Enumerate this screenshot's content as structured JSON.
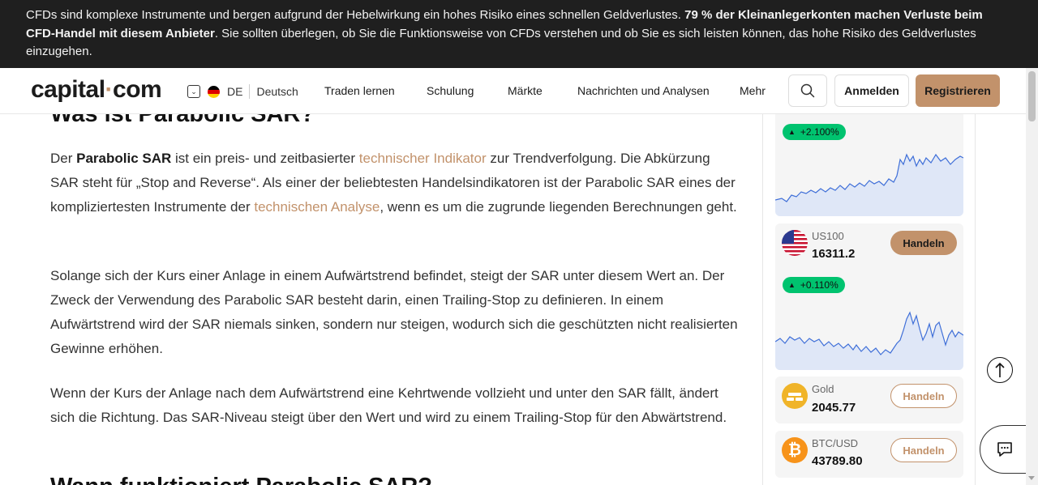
{
  "risk_banner": {
    "text_part1": "CFDs sind komplexe Instrumente und bergen aufgrund der Hebelwirkung ein hohes Risiko eines schnellen Geldverlustes. ",
    "text_bold": "79 % der Kleinanlegerkonten machen Verluste beim CFD-Handel mit diesem Anbieter",
    "text_part2": ". Sie sollten überlegen, ob Sie die Funktionsweise von CFDs verstehen und ob Sie es sich leisten können, das hohe Risiko des Geldverlustes einzugehen."
  },
  "header": {
    "logo_part1": "capital",
    "logo_dot": "·",
    "logo_part2": "com",
    "lang_code": "DE",
    "lang_name": "Deutsch",
    "nav": [
      "Traden lernen",
      "Schulung",
      "Märkte",
      "Nachrichten und Analysen",
      "Mehr"
    ],
    "login_label": "Anmelden",
    "register_label": "Registrieren",
    "search_icon": "search-icon"
  },
  "article": {
    "heading_top": "Was ist Parabolic SAR?",
    "p1_pre": "Der ",
    "p1_bold": "Parabolic SAR",
    "p1_mid1": " ist ein preis- und zeitbasierter ",
    "p1_link1": "technischer Indikator",
    "p1_mid2": " zur Trendverfolgung. Die Abkürzung SAR steht für „Stop and Reverse“. Als einer der beliebtesten Handelsindikatoren ist der Parabolic SAR eines der kompliziertesten Instrumente der ",
    "p1_link2": "technischen Analyse",
    "p1_end": ", wenn es um die zugrunde liegenden Berechnungen geht.",
    "p2": "Solange sich der Kurs einer Anlage in einem Aufwärtstrend befindet, steigt der SAR unter diesem Wert an. Der Zweck der Verwendung des Parabolic SAR besteht darin, einen Trailing-Stop zu definieren. In einem Aufwärtstrend wird der SAR niemals sinken, sondern nur steigen, wodurch sich die geschützten nicht realisierten Gewinne erhöhen.",
    "p3": "Wenn der Kurs der Anlage nach dem Aufwärtstrend eine Kehrtwende vollzieht und unter den SAR fällt, ändert sich die Richtung. Das SAR-Niveau steigt über den Wert und wird zu einem Trailing-Stop für den Abwärtstrend.",
    "heading_bottom": "Wann funktioniert Parabolic SAR?"
  },
  "sidebar": {
    "card_top": {
      "change": "+2.100%"
    },
    "markets": [
      {
        "name": "US100",
        "price": "16311.2",
        "change": "+0.110%",
        "button": "Handeln",
        "icon": "us-flag-icon"
      },
      {
        "name": "Gold",
        "price": "2045.77",
        "button": "Handeln",
        "icon": "gold-icon"
      },
      {
        "name": "BTC/USD",
        "price": "43789.80",
        "button": "Handeln",
        "icon": "bitcoin-icon"
      }
    ]
  },
  "colors": {
    "accent": "#c2926b",
    "positive": "#00c36f",
    "banner_bg": "#1f1f1f",
    "spark_line": "#3f6fd8"
  }
}
